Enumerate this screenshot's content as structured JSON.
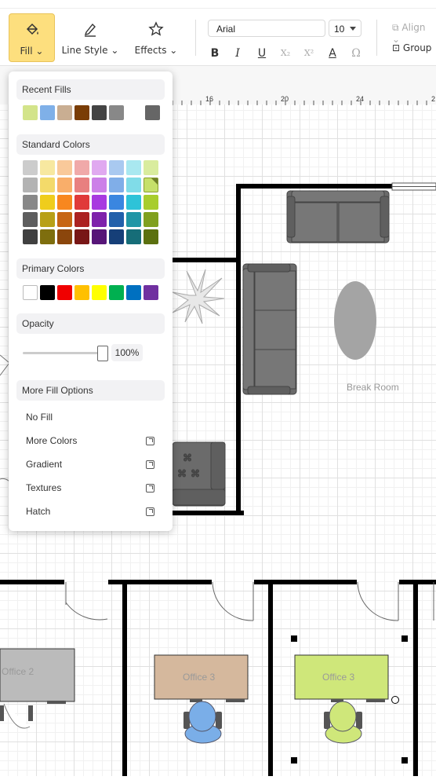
{
  "toolbar": {
    "fill_label": "Fill",
    "line_style_label": "Line Style",
    "effects_label": "Effects",
    "font_name": "Arial",
    "font_size": "10",
    "align_label": "Align",
    "group_label": "Group",
    "format_buttons": [
      "B",
      "I",
      "U",
      "X₂",
      "X²",
      "A",
      "Ω"
    ]
  },
  "ruler": {
    "labels": [
      "16",
      "20",
      "24",
      "2"
    ]
  },
  "fill_panel": {
    "recent_title": "Recent Fills",
    "recent_colors": [
      "#d3e48a",
      "#7fb0e8",
      "#c9ae92",
      "#7a3d06",
      "#444444",
      "#888888",
      "#666666"
    ],
    "standard_title": "Standard Colors",
    "standard_colors": [
      [
        "#cccccc",
        "#f7e8a0",
        "#f9c99a",
        "#f0a9a9",
        "#e0a9f0",
        "#a9c9f0",
        "#a9e8f0",
        "#d9ec9e"
      ],
      [
        "#b3b3b3",
        "#f3da6a",
        "#f9ae6a",
        "#e88080",
        "#cc80e8",
        "#80aee8",
        "#80dce8",
        "#c6e06a"
      ],
      [
        "#888888",
        "#efcd1c",
        "#f8871f",
        "#e03a3a",
        "#a83ae0",
        "#3a86e0",
        "#2ec3d8",
        "#a8cd2e"
      ],
      [
        "#5e5e5e",
        "#b8a017",
        "#c76614",
        "#ab2222",
        "#7e22ab",
        "#2260ab",
        "#2196a6",
        "#80a01f"
      ],
      [
        "#404040",
        "#7e6e0e",
        "#8b460c",
        "#781616",
        "#571678",
        "#163f78",
        "#166d78",
        "#5b700f"
      ]
    ],
    "primary_title": "Primary Colors",
    "primary_colors": [
      "#ffffff",
      "#000000",
      "#f00000",
      "#ffc000",
      "#ffff00",
      "#00b050",
      "#0070c0",
      "#7030a0"
    ],
    "opacity_title": "Opacity",
    "opacity_value": "100%",
    "opacity_fraction": 1.0,
    "more_title": "More Fill Options",
    "options": [
      "No Fill",
      "More Colors",
      "Gradient",
      "Textures",
      "Hatch"
    ]
  },
  "canvas": {
    "break_room_label": "Break Room",
    "offices": [
      {
        "label": "Office 2",
        "color": "#bbbbbb"
      },
      {
        "label": "Office 3",
        "color": "#d5b89d"
      },
      {
        "label": "Office 3",
        "color": "#cfe77a"
      }
    ],
    "chair_colors": [
      "#7aaee8",
      "#cfe77a"
    ]
  }
}
